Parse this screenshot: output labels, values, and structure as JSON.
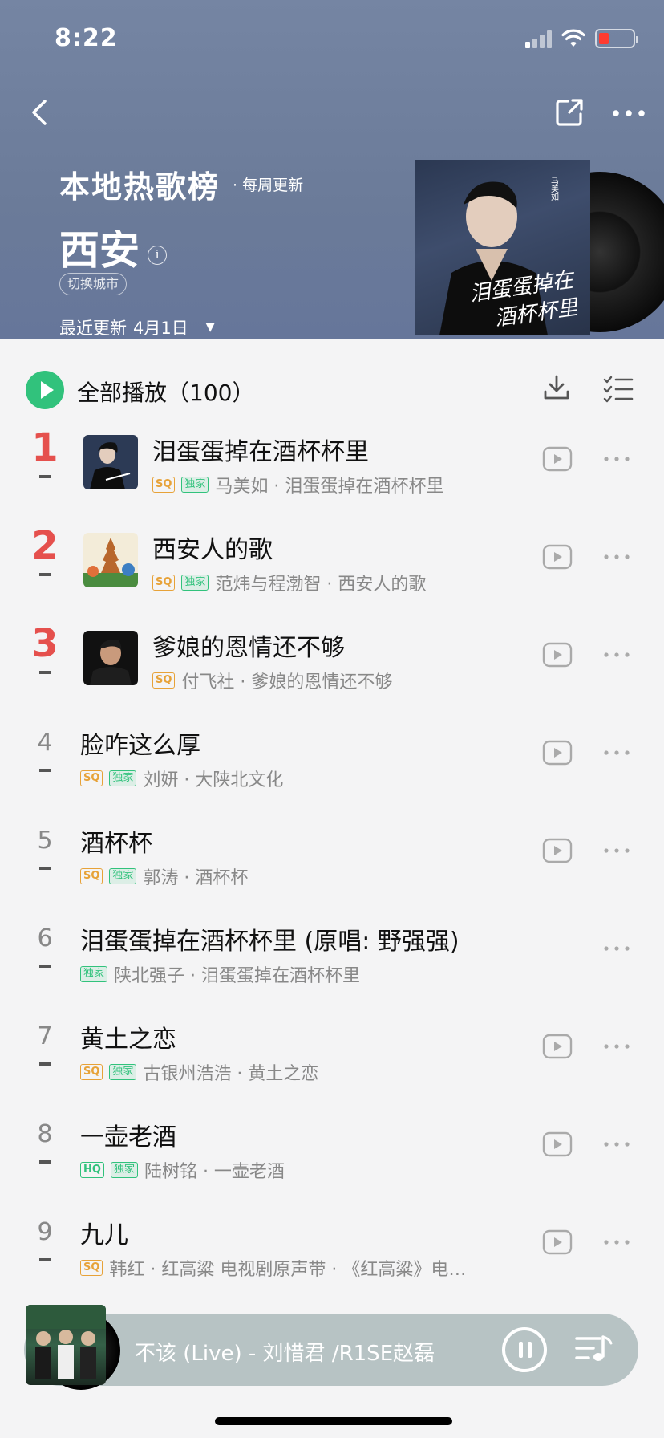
{
  "status_bar": {
    "time": "8:22"
  },
  "header": {
    "chart_title": "本地热歌榜",
    "update_freq": "· 每周更新",
    "city": "西安",
    "info_icon": "i",
    "switch_city": "切换城市",
    "last_update_label": "最近更新",
    "last_update_date": "4月1日",
    "cover_text_artist": "马美如",
    "cover_text_title": "泪蛋蛋掉在酒杯杯里"
  },
  "play_all": {
    "label": "全部播放（100）"
  },
  "songs": [
    {
      "rank": "1",
      "title": "泪蛋蛋掉在酒杯杯里",
      "quality": "SQ",
      "exclusive": "独家",
      "meta": "马美如 · 泪蛋蛋掉在酒杯杯里",
      "has_mv": true
    },
    {
      "rank": "2",
      "title": "西安人的歌",
      "quality": "SQ",
      "exclusive": "独家",
      "meta": "范炜与程渤智 · 西安人的歌",
      "has_mv": true
    },
    {
      "rank": "3",
      "title": "爹娘的恩情还不够",
      "quality": "SQ",
      "exclusive": "",
      "meta": "付飞社 · 爹娘的恩情还不够",
      "has_mv": true
    },
    {
      "rank": "4",
      "title": "脸咋这么厚",
      "quality": "SQ",
      "exclusive": "独家",
      "meta": "刘妍 · 大陕北文化",
      "has_mv": true
    },
    {
      "rank": "5",
      "title": "酒杯杯",
      "quality": "SQ",
      "exclusive": "独家",
      "meta": "郭涛 · 酒杯杯",
      "has_mv": true
    },
    {
      "rank": "6",
      "title": "泪蛋蛋掉在酒杯杯里 (原唱: 野强强)",
      "quality": "",
      "exclusive": "独家",
      "meta": "陕北强子 · 泪蛋蛋掉在酒杯杯里",
      "has_mv": false
    },
    {
      "rank": "7",
      "title": "黄土之恋",
      "quality": "SQ",
      "exclusive": "独家",
      "meta": "古银州浩浩 · 黄土之恋",
      "has_mv": true
    },
    {
      "rank": "8",
      "title": "一壶老酒",
      "quality": "HQ",
      "exclusive": "独家",
      "meta": "陆树铭 · 一壶老酒",
      "has_mv": true
    },
    {
      "rank": "9",
      "title": "九儿",
      "quality": "SQ",
      "exclusive": "",
      "meta": "韩红 · 红高粱 电视剧原声带 · 《红高粱》电…",
      "has_mv": true
    }
  ],
  "mini_player": {
    "now_playing": "不该 (Live) - 刘惜君 /R1SE赵磊"
  },
  "colors": {
    "accent": "#31c27c",
    "rank_top": "#e5504d",
    "sq_tag": "#e7a238",
    "header_bg": "#7080a0"
  },
  "icons": [
    "back-icon",
    "share-icon",
    "more-icon",
    "play-icon",
    "download-icon",
    "multiselect-icon",
    "mv-icon",
    "pause-icon",
    "playlist-icon"
  ]
}
